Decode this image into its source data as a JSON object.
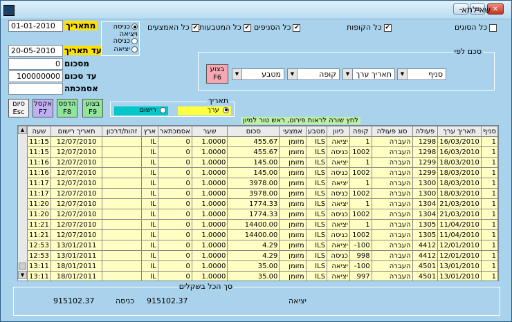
{
  "window": {
    "title": "שאילתא"
  },
  "from_date": {
    "label": "מתאריך",
    "value": "01-01-2010"
  },
  "to_date": {
    "label": "עד תאריך",
    "value": "20-05-2010"
  },
  "from_amount": {
    "label": "מסכום",
    "value": "0"
  },
  "to_amount": {
    "label": "עד סכום",
    "value": "100000000"
  },
  "reference": {
    "label": "אסמכתה",
    "value": ""
  },
  "direction": {
    "options": [
      "כניסה ויציאה",
      "כניסה",
      "יציאה"
    ],
    "selected_index": 0
  },
  "checks": {
    "all_types": "כל הסוגים",
    "all_registers": "כל הקופות",
    "all_currencies": "כל המטבעות",
    "all_branches": "כל הסניפים",
    "all_means": "כל האמצעים"
  },
  "sum_by": {
    "title": "סכם לפי",
    "combos": [
      "סניף",
      "תאריך ערך",
      "קופה",
      "מטבע",
      ""
    ],
    "run_button": "בצוע F6"
  },
  "date_type": {
    "title": "תאריך",
    "options": [
      "ערך",
      "רישום"
    ],
    "selected_index": 0
  },
  "buttons": {
    "exit": [
      "סיום",
      "Esc"
    ],
    "excel": [
      "אקסל",
      "F7"
    ],
    "print": [
      "הדפס",
      "F8"
    ],
    "run": [
      "בצוע",
      "F9"
    ]
  },
  "hint": "לחץ שורה לראות פירוט, ראש טור למיון",
  "grid": {
    "columns": [
      "סניף",
      "תאריך ערך",
      "פעולה",
      "סוג פעולה",
      "קופה",
      "כיוון",
      "מטבע",
      "אמצעי",
      "סכום",
      "שער",
      "אסמכתאר",
      "ארץ",
      "זהות/דרכון",
      "תאריך רישום",
      "שעה"
    ],
    "rows": [
      [
        "1",
        "16/03/2010",
        "1298",
        "העברה",
        "1",
        "יציאה",
        "ILS",
        "מזומן",
        "455.67",
        "1.0000",
        "0",
        "IL",
        "",
        "12/07/2010",
        "11:15"
      ],
      [
        "1",
        "16/03/2010",
        "1298",
        "העברה",
        "1002",
        "כניסה",
        "ILS",
        "מזומן",
        "455.67",
        "1.0000",
        "0",
        "IL",
        "",
        "12/07/2010",
        "11:15"
      ],
      [
        "1",
        "18/03/2010",
        "1299",
        "העברה",
        "1",
        "יציאה",
        "ILS",
        "מזומן",
        "145.00",
        "1.0000",
        "0",
        "IL",
        "",
        "12/07/2010",
        "11:16"
      ],
      [
        "1",
        "18/03/2010",
        "1299",
        "העברה",
        "1002",
        "כניסה",
        "ILS",
        "מזומן",
        "145.00",
        "1.0000",
        "0",
        "IL",
        "",
        "12/07/2010",
        "11:16"
      ],
      [
        "1",
        "18/03/2010",
        "1300",
        "העברה",
        "1",
        "יציאה",
        "ILS",
        "מזומן",
        "3978.00",
        "1.0000",
        "0",
        "IL",
        "",
        "12/07/2010",
        "11:17"
      ],
      [
        "1",
        "18/03/2010",
        "1300",
        "העברה",
        "1002",
        "כניסה",
        "ILS",
        "מזומן",
        "3978.00",
        "1.0000",
        "0",
        "IL",
        "",
        "12/07/2010",
        "11:17"
      ],
      [
        "1",
        "21/03/2010",
        "1304",
        "העברה",
        "1",
        "יציאה",
        "ILS",
        "מזומן",
        "1774.33",
        "1.0000",
        "0",
        "IL",
        "",
        "12/07/2010",
        "11:20"
      ],
      [
        "1",
        "21/03/2010",
        "1304",
        "העברה",
        "1002",
        "כניסה",
        "ILS",
        "מזומן",
        "1774.33",
        "1.0000",
        "0",
        "IL",
        "",
        "12/07/2010",
        "11:20"
      ],
      [
        "1",
        "11/04/2010",
        "1305",
        "העברה",
        "1",
        "יציאה",
        "ILS",
        "מזומן",
        "14400.00",
        "1.0000",
        "0",
        "IL",
        "",
        "12/07/2010",
        "11:21"
      ],
      [
        "1",
        "11/04/2010",
        "1305",
        "העברה",
        "1002",
        "כניסה",
        "ILS",
        "מזומן",
        "14400.00",
        "1.0000",
        "0",
        "IL",
        "",
        "12/07/2010",
        "11:21"
      ],
      [
        "1",
        "12/01/2010",
        "4412",
        "העברה",
        "-100",
        "יציאה",
        "ILS",
        "מזומן",
        "4.29",
        "1.0000",
        "0",
        "IL",
        "",
        "13/01/2011",
        "12:53"
      ],
      [
        "1",
        "12/01/2010",
        "4412",
        "העברה",
        "998",
        "כניסה",
        "ILS",
        "מזומן",
        "4.29",
        "1.0000",
        "0",
        "IL",
        "",
        "13/01/2011",
        "12:53"
      ],
      [
        "1",
        "13/01/2010",
        "4501",
        "העברה",
        "-100",
        "יציאה",
        "ILS",
        "מזומן",
        "35.00",
        "1.0000",
        "0",
        "IL",
        "",
        "18/01/2011",
        "13:11"
      ],
      [
        "1",
        "13/01/2010",
        "4501",
        "העברה",
        "997",
        "יציאה",
        "ILS",
        "מזומן",
        "35.00",
        "1.0000",
        "0",
        "IL",
        "",
        "18/01/2011",
        "13:11"
      ]
    ]
  },
  "totals": {
    "title": "סך הכל בשקלים",
    "out_label": "יציאה",
    "out_value": "915102.37",
    "in_label": "כניסה",
    "in_value": "915102.37"
  },
  "icons": {
    "checkbox_checked": "✔",
    "arrow_down": "▼",
    "arrow_up": "▲"
  }
}
